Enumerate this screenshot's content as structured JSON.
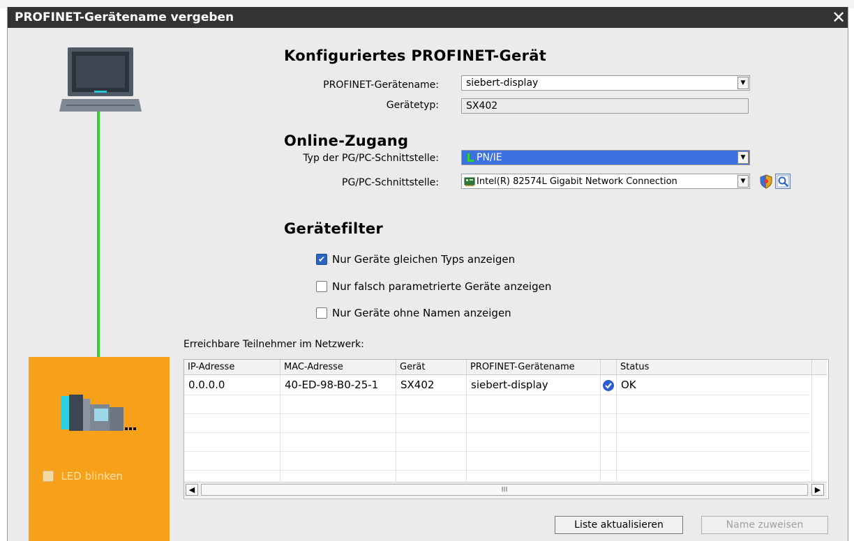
{
  "dialog": {
    "title": "PROFINET-Gerätename vergeben",
    "close_label": "✕"
  },
  "configured": {
    "heading": "Konfiguriertes PROFINET-Gerät",
    "name_label": "PROFINET-Gerätename:",
    "name_value": "siebert-display",
    "type_label": "Gerätetyp:",
    "type_value": "SX402"
  },
  "online": {
    "heading": "Online-Zugang",
    "iface_type_label": "Typ der PG/PC-Schnittstelle:",
    "iface_type_value": "PN/IE",
    "iface_label": "PG/PC-Schnittstelle:",
    "iface_value": "Intel(R) 82574L Gigabit Network Connection"
  },
  "filter": {
    "heading": "Gerätefilter",
    "options": [
      {
        "label": "Nur Geräte gleichen Typs anzeigen",
        "checked": true
      },
      {
        "label": "Nur falsch parametrierte Geräte anzeigen",
        "checked": false
      },
      {
        "label": "Nur Geräte ohne Namen anzeigen",
        "checked": false
      }
    ]
  },
  "network": {
    "label": "Erreichbare Teilnehmer im Netzwerk:",
    "columns": [
      "IP-Adresse",
      "MAC-Adresse",
      "Gerät",
      "PROFINET-Gerätename",
      "Status"
    ],
    "rows": [
      {
        "ip": "0.0.0.0",
        "mac": "40-ED-98-B0-25-1",
        "device": "SX402",
        "name": "siebert-display",
        "status": "OK"
      }
    ]
  },
  "led": {
    "label": "LED blinken",
    "checked": false
  },
  "buttons": {
    "refresh": "Liste aktualisieren",
    "assign": "Name zuweisen"
  },
  "scrollbar": {
    "grip": "III"
  },
  "colors": {
    "accent_selection": "#3b72e0",
    "device_panel": "#f7a11a",
    "link_line": "#2ed12e"
  }
}
